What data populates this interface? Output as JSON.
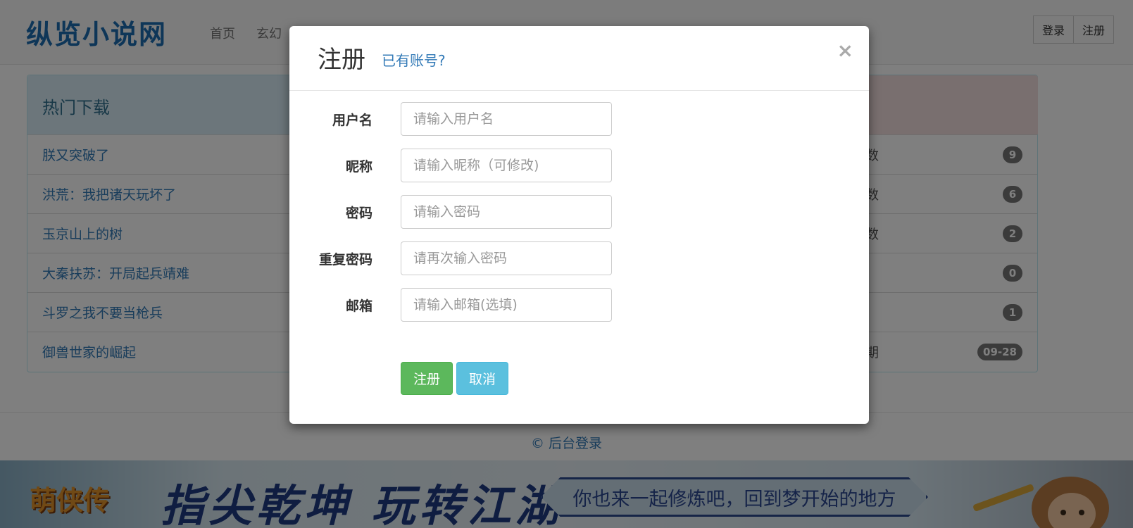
{
  "navbar": {
    "brand": "纵览小说网",
    "links": [
      "首页",
      "玄幻",
      "",
      "",
      ""
    ],
    "login_label": "登录",
    "register_label": "注册"
  },
  "panel": {
    "title": "热门下载",
    "rows": [
      {
        "title": "朕又突破了",
        "right": "数",
        "badge": "9"
      },
      {
        "title": "洪荒：我把诸天玩坏了",
        "right": "数",
        "badge": "6"
      },
      {
        "title": "玉京山上的树",
        "right": "数",
        "badge": "2"
      },
      {
        "title": "大秦扶苏：开局起兵靖难",
        "right": "",
        "badge": "0"
      },
      {
        "title": "斗罗之我不要当枪兵",
        "right": "",
        "badge": "1"
      },
      {
        "title": "御兽世家的崛起",
        "right": "期",
        "badge": "09-28"
      }
    ]
  },
  "footer": {
    "text": "© 后台登录"
  },
  "banner": {
    "logo": "萌侠传",
    "slogan": "指尖乾坤 玩转江湖",
    "plate": "你也来一起修炼吧，回到梦开始的地方"
  },
  "modal": {
    "title": "注册",
    "link": "已有账号?",
    "close": "×",
    "fields": [
      {
        "label": "用户名",
        "placeholder": "请输入用户名"
      },
      {
        "label": "昵称",
        "placeholder": "请输入昵称（可修改)"
      },
      {
        "label": "密码",
        "placeholder": "请输入密码"
      },
      {
        "label": "重复密码",
        "placeholder": "请再次输入密码"
      },
      {
        "label": "邮箱",
        "placeholder": "请输入邮箱(选填)"
      }
    ],
    "submit_label": "注册",
    "cancel_label": "取消"
  },
  "colors": {
    "brand": "#1c6cb0",
    "link": "#337ab7",
    "success": "#5cb85c",
    "info": "#5bc0de",
    "badge": "#777777"
  }
}
